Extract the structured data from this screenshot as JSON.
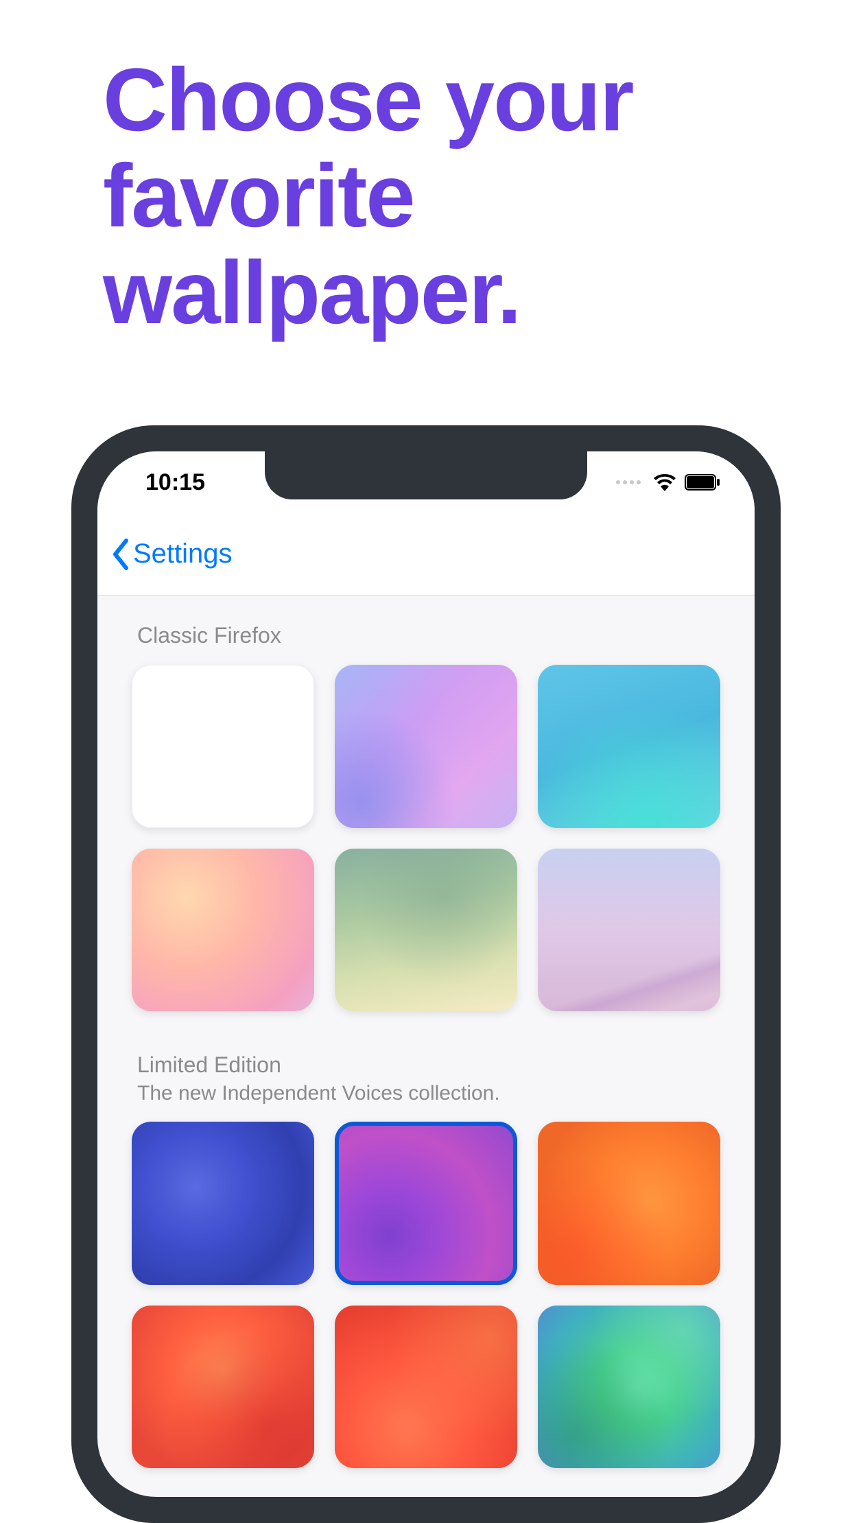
{
  "marketing": {
    "headline": "Choose your favorite wallpaper."
  },
  "statusBar": {
    "time": "10:15"
  },
  "nav": {
    "backLabel": "Settings"
  },
  "sections": {
    "classic": {
      "title": "Classic Firefox"
    },
    "limited": {
      "title": "Limited Edition",
      "subtitle": "The new Independent Voices collection."
    }
  },
  "wallpapers": {
    "classic": [
      {
        "name": "default-white",
        "selected": false
      },
      {
        "name": "purple-haze",
        "selected": false
      },
      {
        "name": "cyan-wave",
        "selected": false
      },
      {
        "name": "peach-blur",
        "selected": false
      },
      {
        "name": "sage-mist",
        "selected": false
      },
      {
        "name": "lilac-dune",
        "selected": false
      }
    ],
    "limited": [
      {
        "name": "blue-voice",
        "selected": false
      },
      {
        "name": "magenta-voice",
        "selected": true
      },
      {
        "name": "orange-voice",
        "selected": false
      },
      {
        "name": "red-voice",
        "selected": false
      },
      {
        "name": "redorange-voice",
        "selected": false
      },
      {
        "name": "green-voice",
        "selected": false
      }
    ]
  }
}
